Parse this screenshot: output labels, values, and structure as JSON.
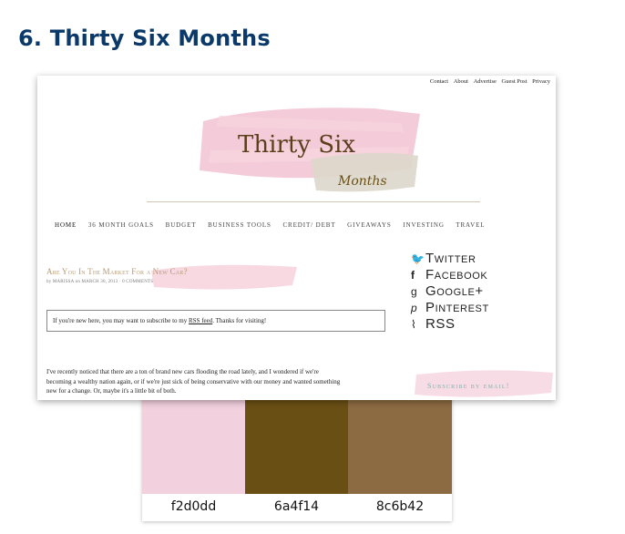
{
  "heading": "6. Thirty Six Months",
  "screenshot": {
    "top_links": [
      "Contact",
      "About",
      "Advertise",
      "Guest Post",
      "Privacy"
    ],
    "logo": {
      "line1": "Thirty Six",
      "line2": "Months"
    },
    "nav": [
      "HOME",
      "36 MONTH GOALS",
      "BUDGET",
      "BUSINESS TOOLS",
      "CREDIT/ DEBT",
      "GIVEAWAYS",
      "INVESTING",
      "TRAVEL"
    ],
    "post": {
      "title": "Are You In The Market For a New Car?",
      "meta": "by MARISSA on MARCH 30, 2013 · 0 COMMENTS",
      "rss_notice_before": "If you're new here, you may want to subscribe to my ",
      "rss_notice_link": "RSS feed",
      "rss_notice_after": ". Thanks for visiting!",
      "body_line1": "I've recently noticed that there are a ton of brand new cars flooding the road lately,  and I wondered if we're",
      "body_line2": "becoming a wealthy nation again, or if we're just sick of being conservative with our money and wanted something",
      "body_line3": "new for a change. Or, maybe it's a little bit of both."
    },
    "social": [
      {
        "icon": "twitter-icon",
        "glyph": "🐦",
        "label": "Twitter"
      },
      {
        "icon": "facebook-icon",
        "glyph": "f",
        "label": "Facebook"
      },
      {
        "icon": "google-plus-icon",
        "glyph": "g",
        "label": "Google+"
      },
      {
        "icon": "pinterest-icon",
        "glyph": "p",
        "label": "Pinterest"
      },
      {
        "icon": "rss-icon",
        "glyph": "⌇",
        "label": "RSS"
      }
    ],
    "subscribe": "Subscribe by email!"
  },
  "palette": [
    {
      "hex": "f2d0dd",
      "color": "#f2d0dd"
    },
    {
      "hex": "6a4f14",
      "color": "#6a4f14"
    },
    {
      "hex": "8c6b42",
      "color": "#8c6b42"
    }
  ]
}
